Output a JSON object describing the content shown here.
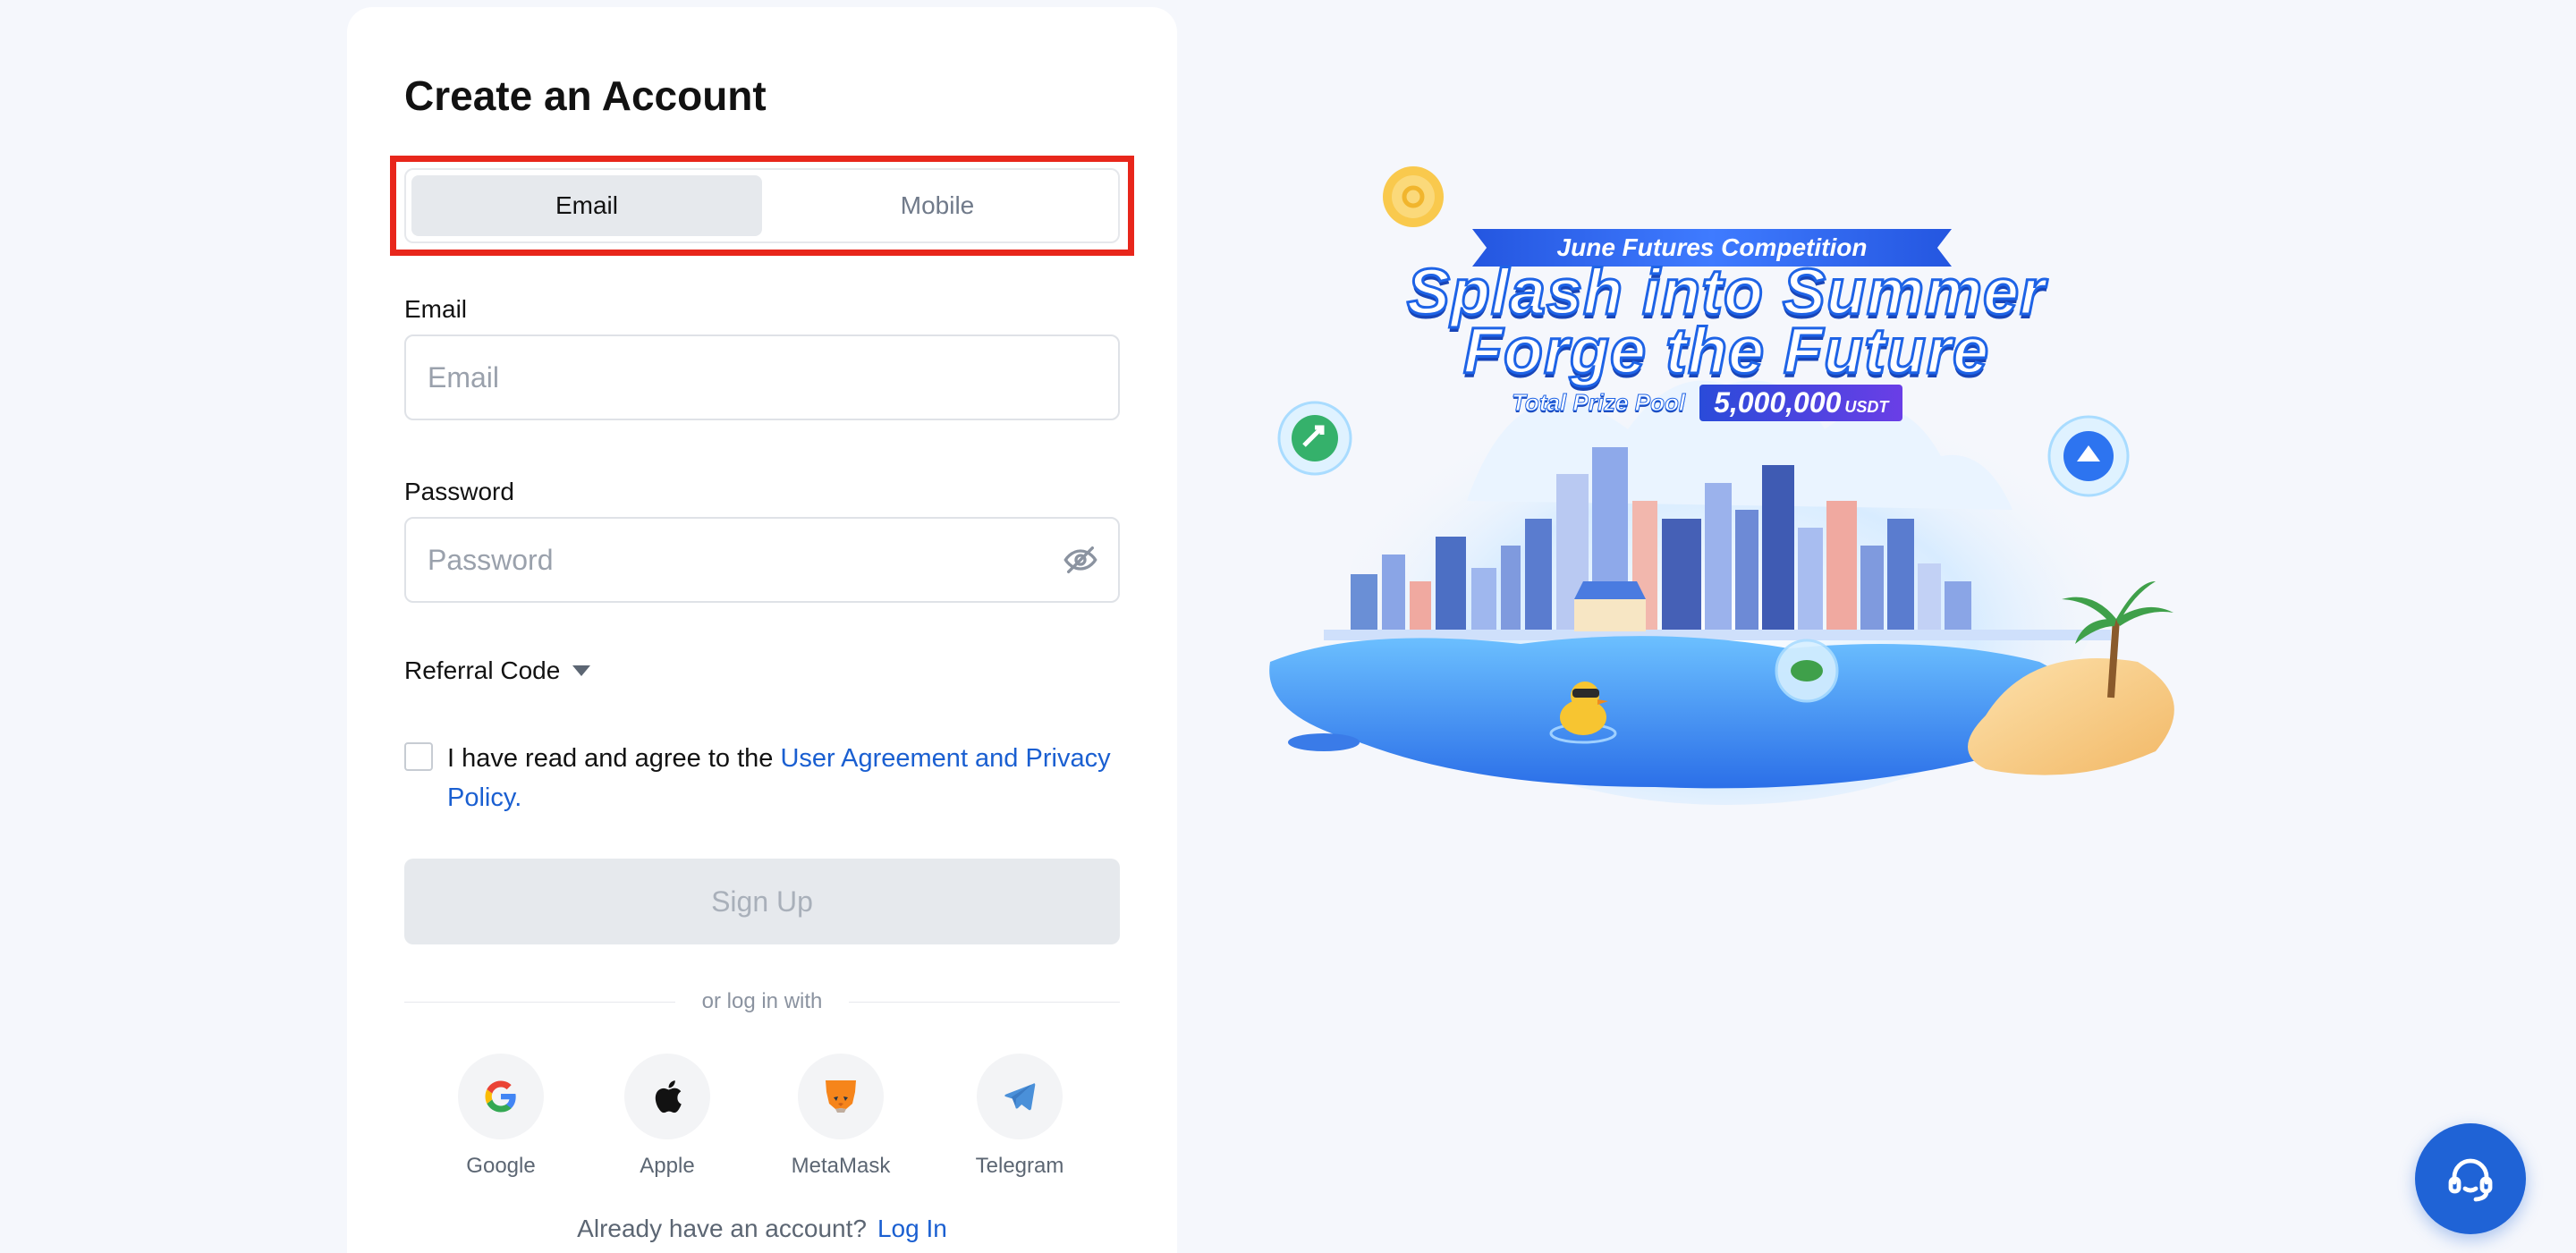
{
  "form": {
    "title": "Create an Account",
    "tabs": [
      {
        "label": "Email",
        "active": true
      },
      {
        "label": "Mobile",
        "active": false
      }
    ],
    "email": {
      "label": "Email",
      "placeholder": "Email",
      "value": ""
    },
    "password": {
      "label": "Password",
      "placeholder": "Password",
      "value": "",
      "icon": "eye-off-icon"
    },
    "referral": {
      "label": "Referral Code",
      "icon": "caret-down-icon"
    },
    "agreement": {
      "text": "I have read and agree to the ",
      "link": "User Agreement and Privacy Policy.",
      "checked": false
    },
    "signup_label": "Sign Up",
    "divider_text": "or log in with",
    "social": [
      {
        "label": "Google",
        "icon": "google-icon"
      },
      {
        "label": "Apple",
        "icon": "apple-icon"
      },
      {
        "label": "MetaMask",
        "icon": "metamask-icon"
      },
      {
        "label": "Telegram",
        "icon": "telegram-icon"
      }
    ],
    "login_prompt": "Already have an account?",
    "login_link": "Log In"
  },
  "banner": {
    "badge": "June Futures Competition",
    "line1": "Splash into Summer",
    "line2": "Forge the Future",
    "prize_label": "Total Prize Pool",
    "prize_amount": "5,000,000",
    "prize_unit": "USDT"
  },
  "support": {
    "icon": "headset-icon"
  },
  "colors": {
    "accent": "#1a5fd1",
    "highlight": "#e8261b",
    "page_bg": "#f5f7fc"
  }
}
